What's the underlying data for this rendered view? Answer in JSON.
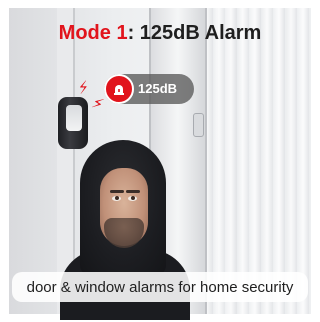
{
  "title": {
    "prefix": "Mode 1",
    "rest": ": 125dB Alarm"
  },
  "badge": {
    "label": "125dB"
  },
  "caption": "door & window alarms for home security",
  "icons": {
    "badge_icon": "alarm-siren-icon",
    "sound_wave": "sound-wave-icon"
  },
  "colors": {
    "accent": "#e1141c",
    "title_text": "#1f1f1f",
    "badge_bg": "#5a5a5a"
  }
}
